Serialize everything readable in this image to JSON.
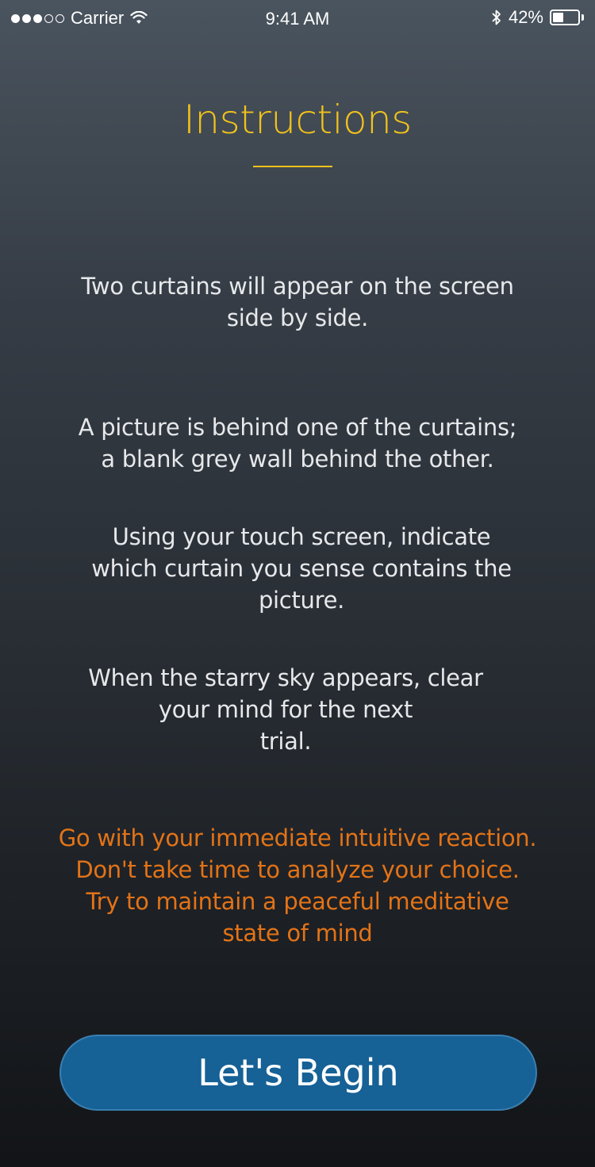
{
  "status_bar": {
    "carrier": "Carrier",
    "time": "9:41 AM",
    "battery": "42%",
    "battery_level": 0.42,
    "signal_dots_full": 3,
    "signal_dots_total": 5,
    "icons": [
      "signal-dots-icon",
      "wifi-icon",
      "bluetooth-icon",
      "battery-icon"
    ]
  },
  "title": "Instructions",
  "paragraphs": [
    "Two curtains will appear on the screen\nside by side.",
    "A picture is behind one of the curtains;\na blank grey wall behind the other.",
    "Using your touch screen, indicate\nwhich curtain you sense contains the\npicture.",
    "When the starry sky appears, clear\nyour mind for the next\ntrial."
  ],
  "advice": "Go with your immediate intuitive reaction.\nDon't take time to analyze your choice.\nTry to maintain a peaceful meditative\nstate of mind",
  "begin_button": "Let's Begin",
  "colors": {
    "title": "#f2c21a",
    "body_text": "#e6e8ea",
    "advice_text": "#e37317",
    "button_bg": "#166196",
    "button_border": "#3a7fb0"
  }
}
